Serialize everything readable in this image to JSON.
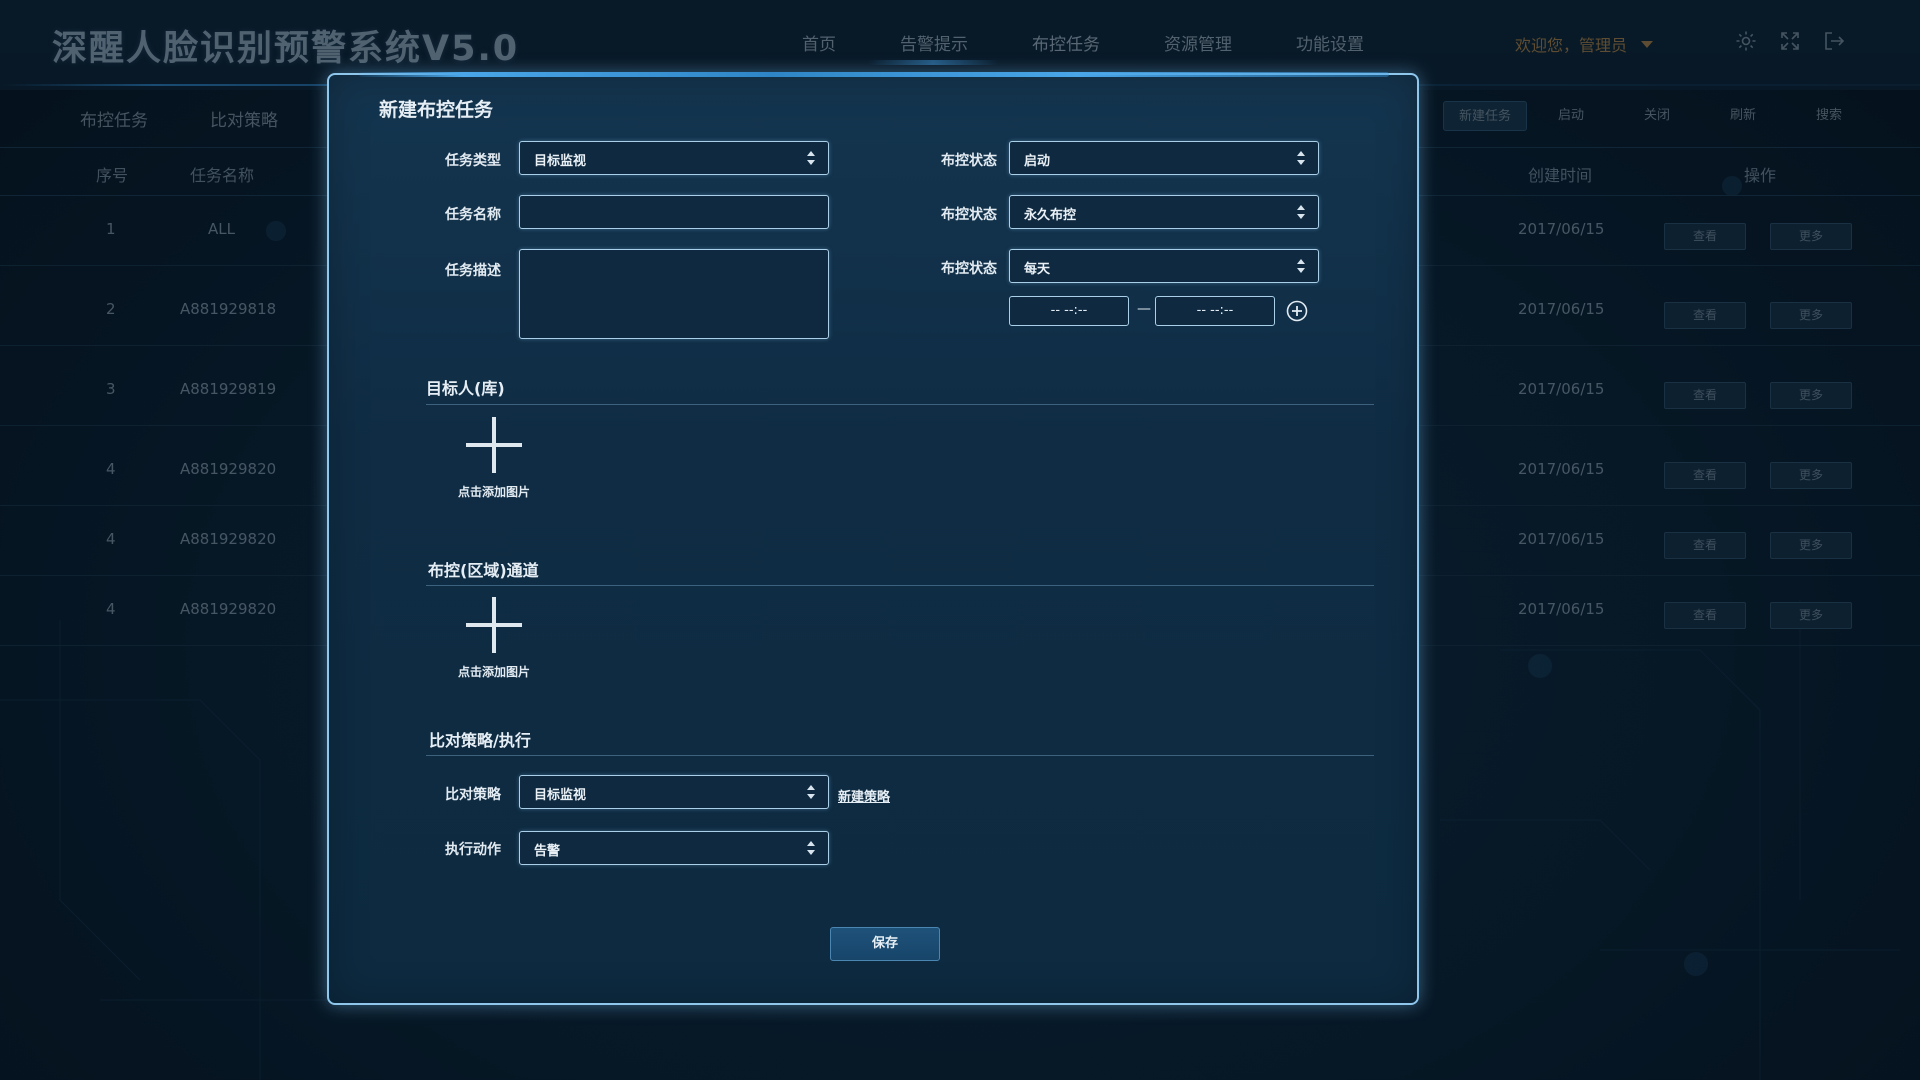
{
  "app": {
    "title": "深醒人脸识别预警系统V5.0"
  },
  "top_nav": {
    "items": [
      "首页",
      "告警提示",
      "布控任务",
      "资源管理",
      "功能设置"
    ],
    "active": "布控任务"
  },
  "user": {
    "greeting": "欢迎您，管理员"
  },
  "header_icons": [
    "settings-icon",
    "fullscreen-icon",
    "logout-icon"
  ],
  "sub_tabs": [
    "布控任务",
    "比对策略"
  ],
  "toolbar": {
    "new_task": "新建任务",
    "start": "启动",
    "close": "关闭",
    "refresh": "刷新",
    "search": "搜索"
  },
  "table": {
    "columns": {
      "index": "序号",
      "name": "任务名称",
      "created": "创建时间",
      "ops": "操作"
    },
    "rows": [
      {
        "index": "1",
        "name": "ALL",
        "created": "2017/06/15",
        "view": "查看",
        "more": "更多"
      },
      {
        "index": "2",
        "name": "A881929818",
        "created": "2017/06/15",
        "view": "查看",
        "more": "更多"
      },
      {
        "index": "3",
        "name": "A881929819",
        "created": "2017/06/15",
        "view": "查看",
        "more": "更多"
      },
      {
        "index": "4",
        "name": "A881929820",
        "created": "2017/06/15",
        "view": "查看",
        "more": "更多"
      },
      {
        "index": "4",
        "name": "A881929820",
        "created": "2017/06/15",
        "view": "查看",
        "more": "更多"
      },
      {
        "index": "4",
        "name": "A881929820",
        "created": "2017/06/15",
        "view": "查看",
        "more": "更多"
      }
    ]
  },
  "modal": {
    "title": "新建布控任务",
    "task_type_label": "任务类型",
    "task_type_value": "目标监视",
    "task_name_label": "任务名称",
    "task_name_value": "",
    "task_desc_label": "任务描述",
    "task_desc_value": "",
    "status1_label": "布控状态",
    "status1_value": "启动",
    "status2_label": "布控状态",
    "status2_value": "永久布控",
    "status3_label": "布控状态",
    "status3_value": "每天",
    "time_start": "-- --:--",
    "time_end": "-- --:--",
    "time_sep": "—",
    "section_target": "目标人(库)",
    "add_image_1": "点击添加图片",
    "section_channel": "布控(区域)通道",
    "add_image_2": "点击添加图片",
    "section_strategy": "比对策略/执行",
    "strategy_label": "比对策略",
    "strategy_value": "目标监视",
    "new_strategy": "新建策略",
    "action_label": "执行动作",
    "action_value": "告警",
    "save": "保存"
  }
}
